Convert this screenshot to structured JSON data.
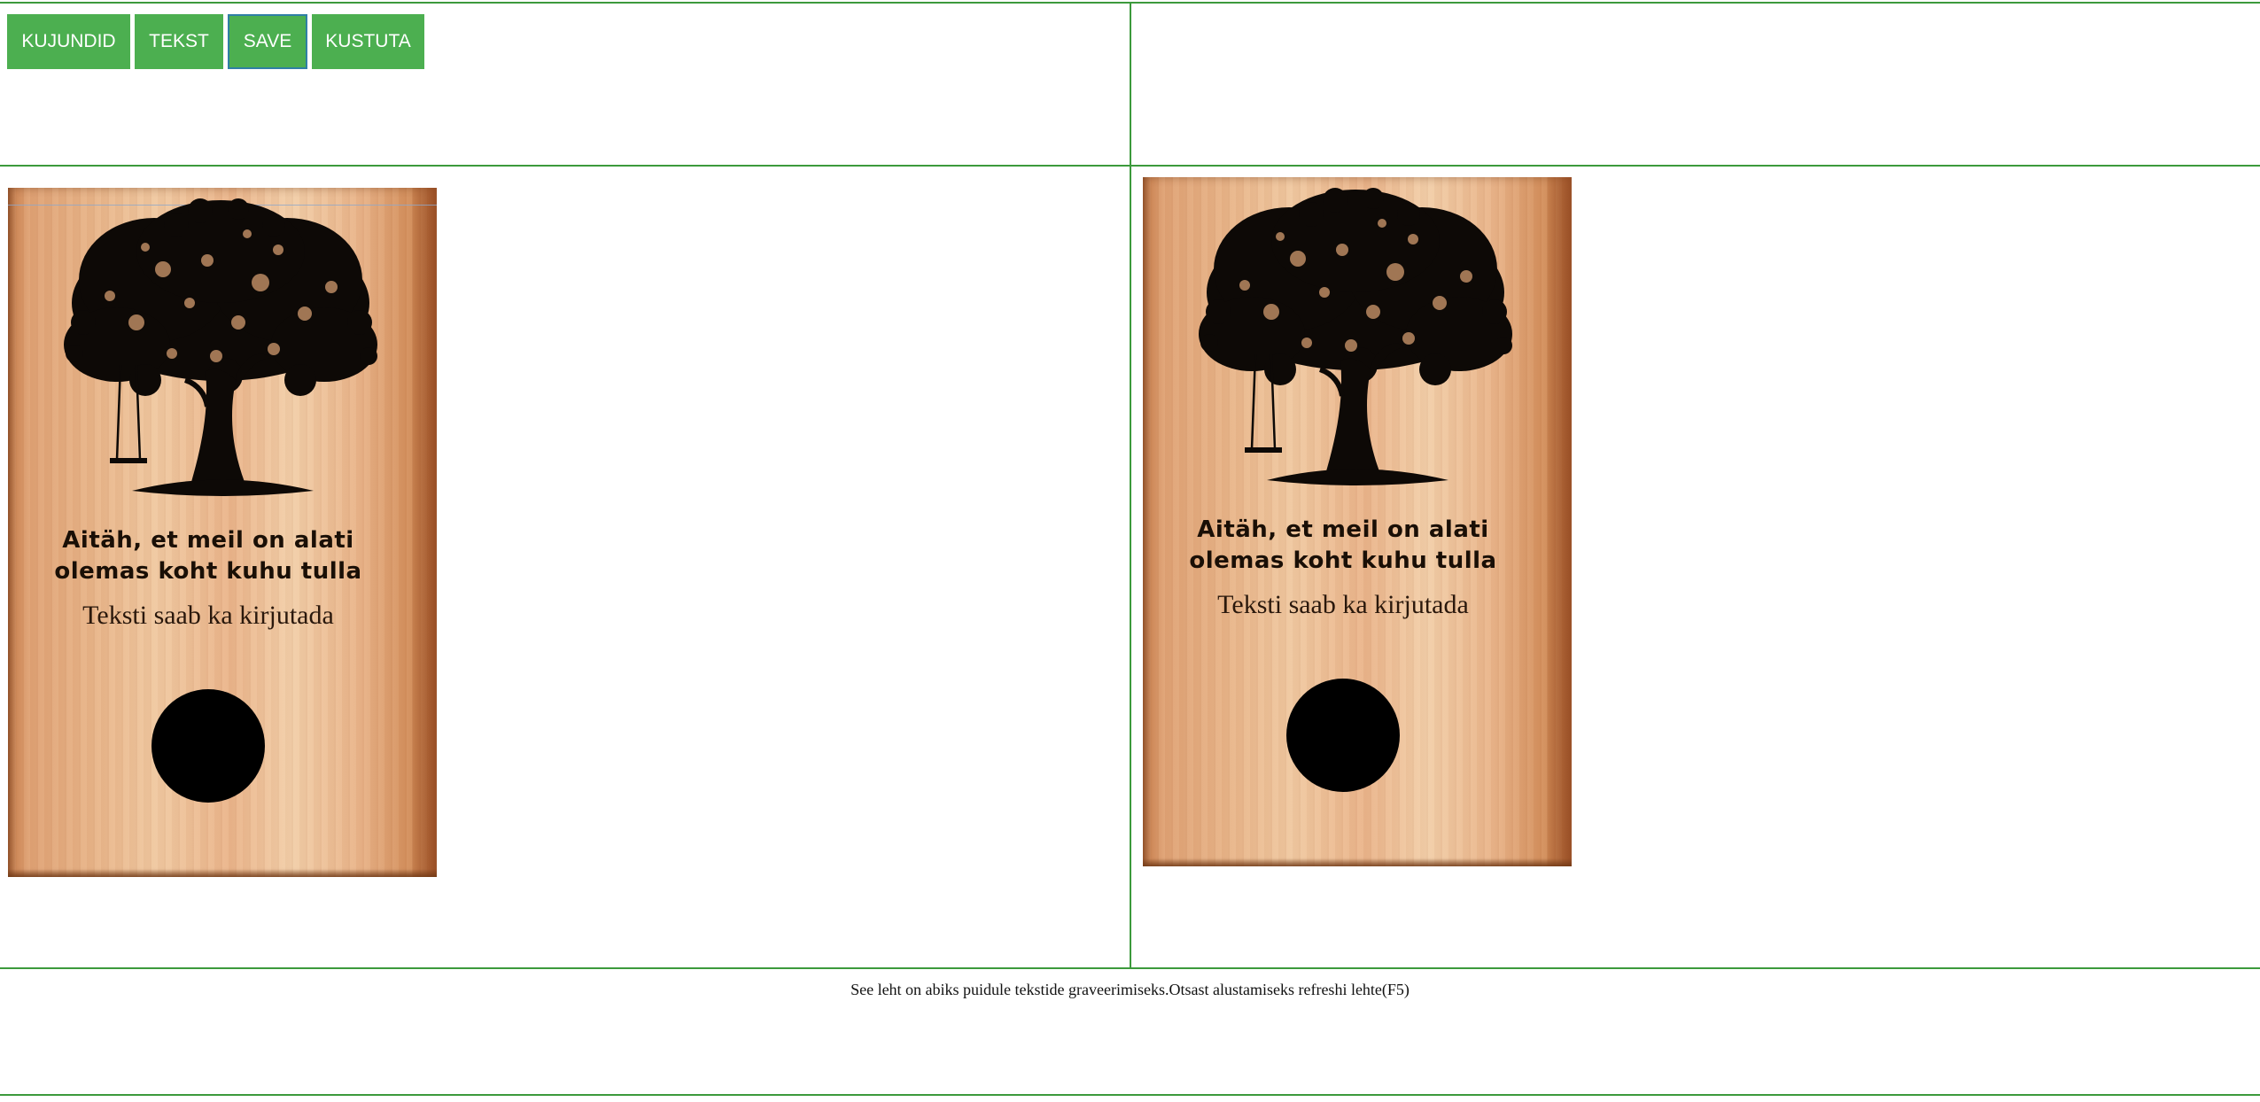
{
  "toolbar": {
    "buttons": [
      {
        "label": "KUJUNDID"
      },
      {
        "label": "TEKST"
      },
      {
        "label": "SAVE"
      },
      {
        "label": "KUSTUTA"
      }
    ]
  },
  "editor_board": {
    "headline_line1": "Aitäh, et meil on alati",
    "headline_line2": "olemas koht kuhu tulla",
    "custom_text": "Teksti saab ka kirjutada"
  },
  "preview_board": {
    "headline_line1": "Aitäh, et meil on alati",
    "headline_line2": "olemas koht kuhu tulla",
    "custom_text": "Teksti saab ka kirjutada"
  },
  "footer": {
    "text": "See leht on abiks puidule tekstide graveerimiseks.Otsast alustamiseks refreshi lehte(F5)"
  },
  "colors": {
    "accent": "#4caf50",
    "divider": "#3c9a3c",
    "wood": "#e8b58a"
  },
  "icons": [
    "tree-with-swing-icon",
    "circle-shape"
  ]
}
